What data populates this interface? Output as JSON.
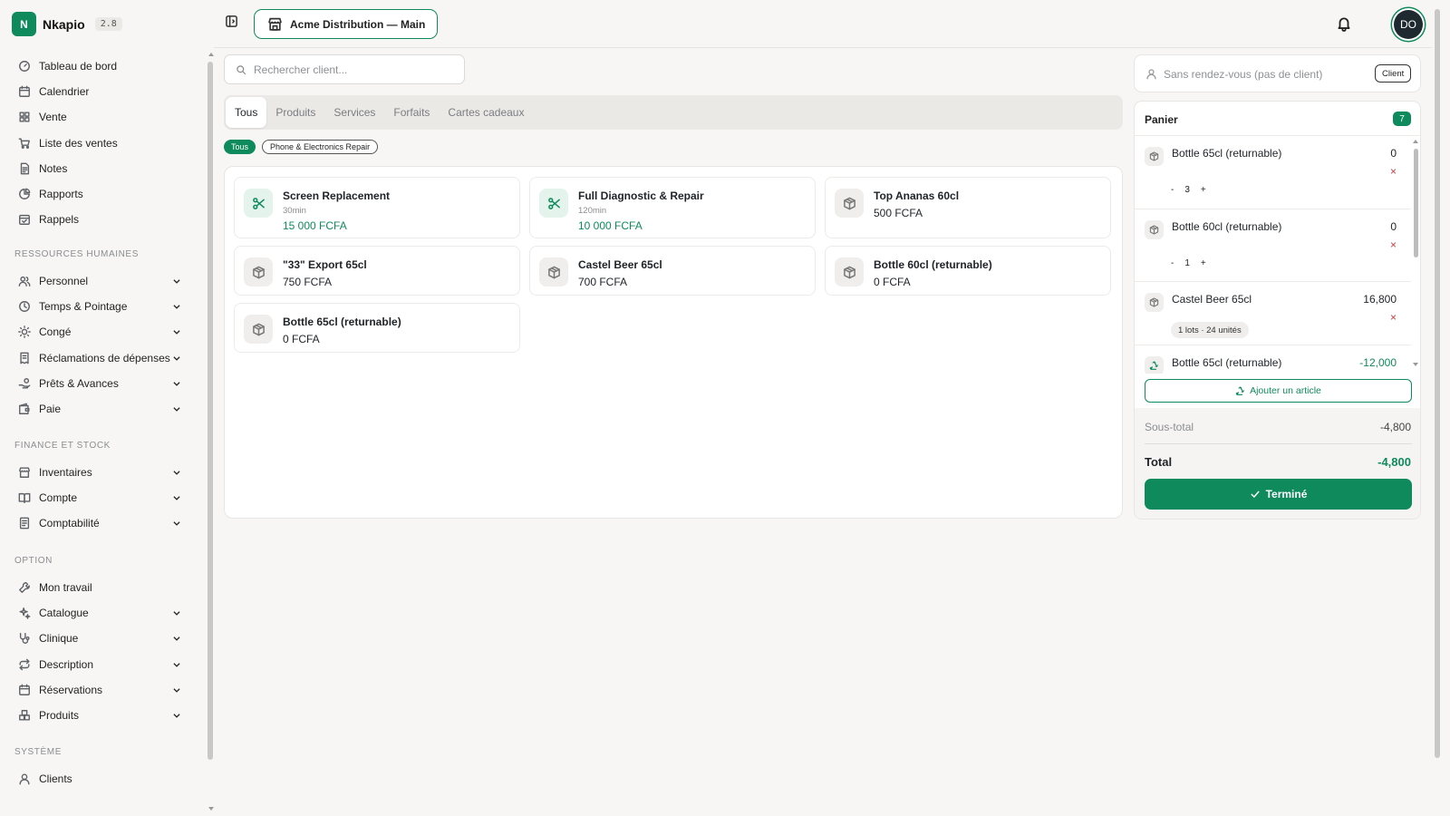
{
  "app": {
    "logo_letter": "N",
    "name": "Nkapio",
    "version": "2.8"
  },
  "colors": {
    "accent": "#0e8a5c",
    "danger": "#d23b3b"
  },
  "sidebar": {
    "main_items": [
      {
        "label": "Tableau de bord",
        "icon": "dashboard-gauge-icon"
      },
      {
        "label": "Calendrier",
        "icon": "calendar-icon"
      },
      {
        "label": "Vente",
        "icon": "grid-icon"
      },
      {
        "label": "Liste des ventes",
        "icon": "cart-icon"
      },
      {
        "label": "Notes",
        "icon": "document-icon"
      },
      {
        "label": "Rapports",
        "icon": "pie-chart-icon"
      },
      {
        "label": "Rappels",
        "icon": "calendar-check-icon"
      }
    ],
    "sections": [
      {
        "title": "RESSOURCES HUMAINES",
        "items": [
          {
            "label": "Personnel",
            "icon": "users-icon"
          },
          {
            "label": "Temps & Pointage",
            "icon": "clock-icon"
          },
          {
            "label": "Congé",
            "icon": "sun-icon"
          },
          {
            "label": "Réclamations de dépenses",
            "icon": "receipt-icon"
          },
          {
            "label": "Prêts & Avances",
            "icon": "hand-coins-icon"
          },
          {
            "label": "Paie",
            "icon": "wallet-icon"
          }
        ]
      },
      {
        "title": "FINANCE ET STOCK",
        "items": [
          {
            "label": "Inventaires",
            "icon": "store-icon"
          },
          {
            "label": "Compte",
            "icon": "book-open-icon"
          },
          {
            "label": "Comptabilité",
            "icon": "ledger-icon"
          }
        ]
      },
      {
        "title": "OPTION",
        "items": [
          {
            "label": "Mon travail",
            "icon": "wrench-icon"
          },
          {
            "label": "Catalogue",
            "icon": "sparkles-icon"
          },
          {
            "label": "Clinique",
            "icon": "stethoscope-icon"
          },
          {
            "label": "Description",
            "icon": "repeat-icon"
          },
          {
            "label": "Réservations",
            "icon": "calendar-icon"
          },
          {
            "label": "Produits",
            "icon": "boxes-icon"
          }
        ]
      },
      {
        "title": "SYSTÈME",
        "items": [
          {
            "label": "Clients",
            "icon": "user-icon"
          }
        ]
      }
    ]
  },
  "header": {
    "store_label": "Acme Distribution — Main",
    "avatar_initials": "DO"
  },
  "search": {
    "placeholder": "Rechercher client..."
  },
  "tabs": [
    {
      "label": "Tous",
      "active": true
    },
    {
      "label": "Produits",
      "active": false
    },
    {
      "label": "Services",
      "active": false
    },
    {
      "label": "Forfaits",
      "active": false
    },
    {
      "label": "Cartes cadeaux",
      "active": false
    }
  ],
  "categories": [
    {
      "label": "Tous",
      "active": true
    },
    {
      "label": "Phone & Electronics Repair",
      "active": false
    }
  ],
  "items": [
    {
      "name": "Screen Replacement",
      "duration": "30min",
      "price": "15 000 FCFA",
      "kind": "service"
    },
    {
      "name": "Full Diagnostic & Repair",
      "duration": "120min",
      "price": "10 000 FCFA",
      "kind": "service"
    },
    {
      "name": "Top Ananas 60cl",
      "duration": "",
      "price": "500 FCFA",
      "kind": "product"
    },
    {
      "name": "\"33\" Export 65cl",
      "duration": "",
      "price": "750 FCFA",
      "kind": "product"
    },
    {
      "name": "Castel Beer 65cl",
      "duration": "",
      "price": "700 FCFA",
      "kind": "product"
    },
    {
      "name": "Bottle 60cl (returnable)",
      "duration": "",
      "price": "0 FCFA",
      "kind": "product"
    },
    {
      "name": "Bottle 65cl (returnable)",
      "duration": "",
      "price": "0 FCFA",
      "kind": "product"
    }
  ],
  "client": {
    "placeholder": "Sans rendez-vous (pas de client)",
    "button_label": "Client"
  },
  "cart": {
    "title": "Panier",
    "count": "7",
    "lines": [
      {
        "name": "Bottle 65cl (returnable)",
        "amount": "0",
        "quantity": "3",
        "type": "qty"
      },
      {
        "name": "Bottle 60cl (returnable)",
        "amount": "0",
        "quantity": "1",
        "type": "qty"
      },
      {
        "name": "Castel Beer 65cl",
        "amount": "16,800",
        "lots": "1 lots · 24 unités",
        "type": "lots"
      },
      {
        "name": "Bottle 65cl (returnable)",
        "amount": "-12,000",
        "type": "return"
      }
    ],
    "minus_label": "-",
    "plus_label": "+",
    "remove_label": "×",
    "add_item_label": "Ajouter un article",
    "subtotal_label": "Sous-total",
    "subtotal_value": "-4,800",
    "total_label": "Total",
    "total_value": "-4,800",
    "done_label": "Terminé"
  }
}
